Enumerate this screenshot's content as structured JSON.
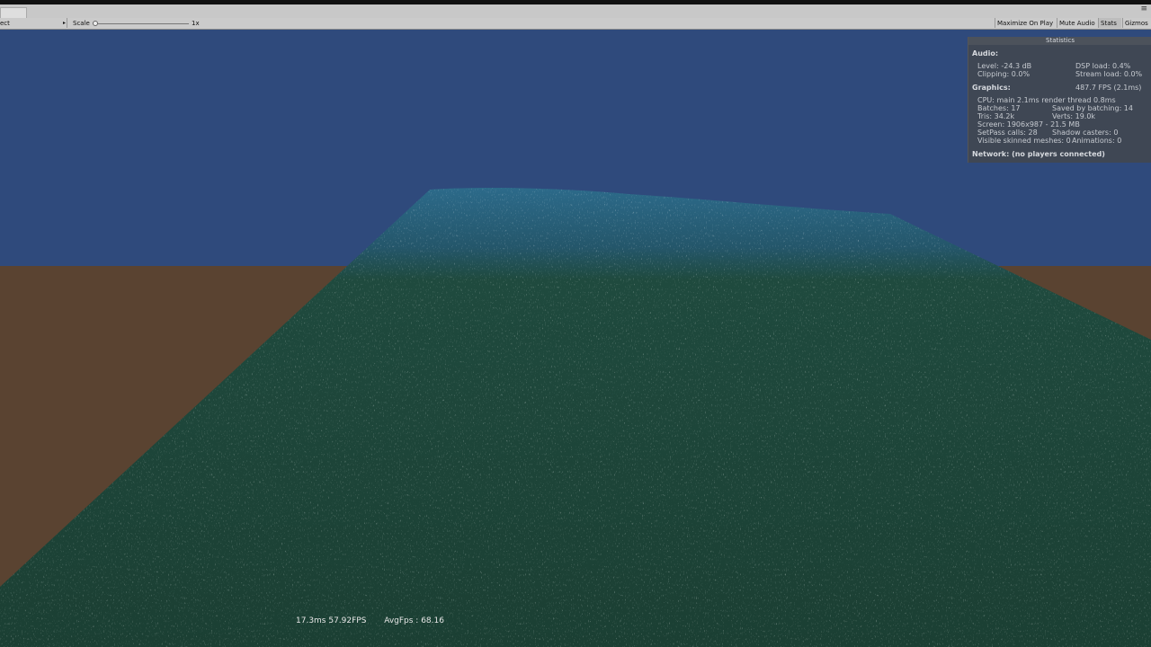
{
  "editor": {
    "window_controls": "≡",
    "toolbar": {
      "aspect_dropdown": "ect",
      "aspect_arrow": "▸",
      "scale_label": "Scale",
      "scale_value": "1x",
      "buttons": [
        "Maximize On Play",
        "Mute Audio",
        "Stats",
        "Gizmos"
      ]
    }
  },
  "stats_panel": {
    "title": "Statistics",
    "audio": {
      "heading": "Audio:",
      "level": "Level: -24.3 dB",
      "dsp_load": "DSP load: 0.4%",
      "clipping": "Clipping: 0.0%",
      "stream_load": "Stream load: 0.0%"
    },
    "graphics": {
      "heading": "Graphics:",
      "fps": "487.7 FPS (2.1ms)",
      "cpu": "CPU: main 2.1ms  render thread 0.8ms",
      "batches": "Batches: 17",
      "saved_by_batching": "Saved by batching: 14",
      "tris": "Tris: 34.2k",
      "verts": "Verts: 19.0k",
      "screen": "Screen: 1906x987 - 21.5 MB",
      "setpass": "SetPass calls: 28",
      "shadow_casters": "Shadow casters: 0",
      "skinned_meshes": "Visible skinned meshes: 0",
      "animations": "Animations: 0"
    },
    "network": "Network: (no players connected)"
  },
  "hud": {
    "frame_time": "17.3ms 57.92FPS",
    "avg_fps": "AvgFps : 68.16"
  },
  "colors": {
    "sky": "#2f4a7c",
    "ground": "#5a4331",
    "ocean": "#1f4a3c",
    "ocean_far": "#2a6585",
    "toolbar": "#cbcbcb"
  }
}
